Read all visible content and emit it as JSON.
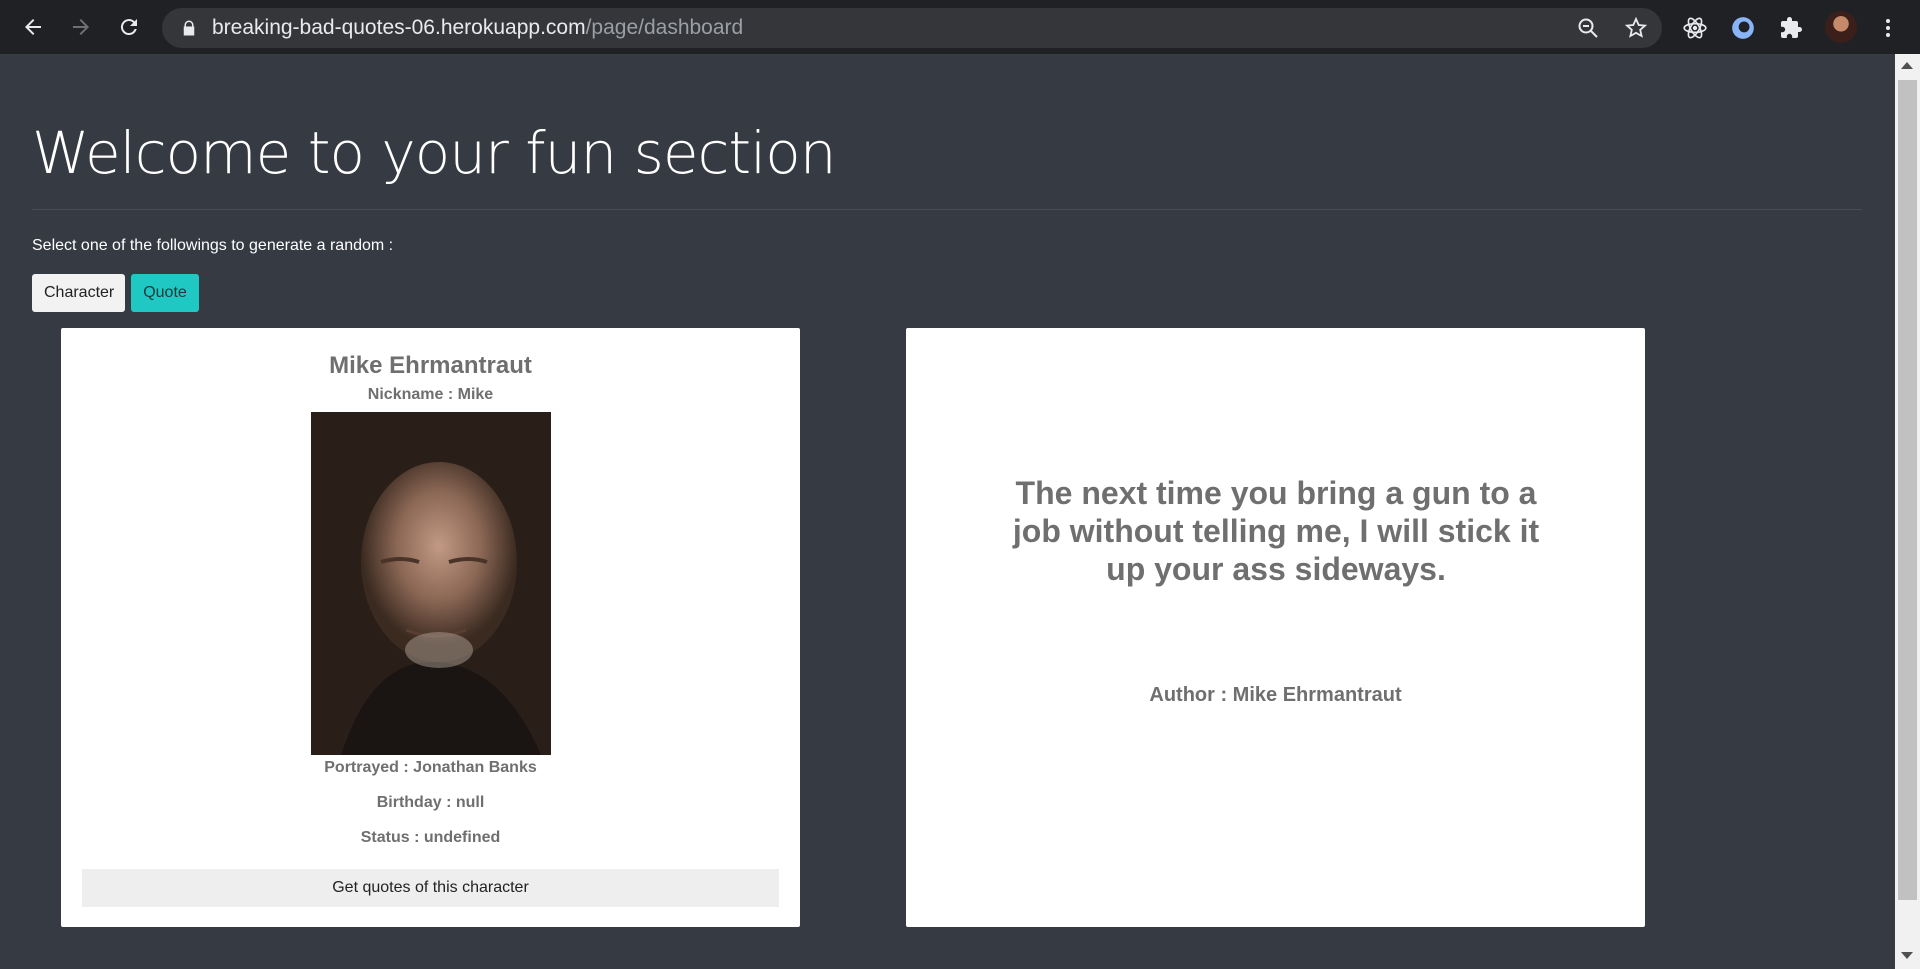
{
  "browser": {
    "url_domain": "breaking-bad-quotes-06.herokuapp.com",
    "url_path": "/page/dashboard",
    "icons": [
      "back-icon",
      "forward-icon",
      "reload-icon",
      "lock-icon",
      "zoom-out-icon",
      "star-icon",
      "react-icon",
      "extension-circle-icon",
      "puzzle-icon",
      "menu-icon"
    ]
  },
  "main": {
    "title": "Welcome to your fun section",
    "subtitle": "Select one of the followings to generate a random :",
    "buttons": {
      "character": "Character",
      "quote": "Quote"
    }
  },
  "character_card": {
    "name": "Mike Ehrmantraut",
    "nickname": "Nickname : Mike",
    "portrayed": "Portrayed : Jonathan Banks",
    "birthday": "Birthday : null",
    "status": "Status : undefined",
    "button": "Get quotes of this character"
  },
  "quote_card": {
    "quote": "The next time you bring a gun to a job without telling me, I will stick it up your ass sideways.",
    "author": "Author : Mike Ehrmantraut"
  },
  "colors": {
    "background": "#363a42",
    "accent": "#1fc8c3",
    "card_text": "#6f6f6f"
  }
}
